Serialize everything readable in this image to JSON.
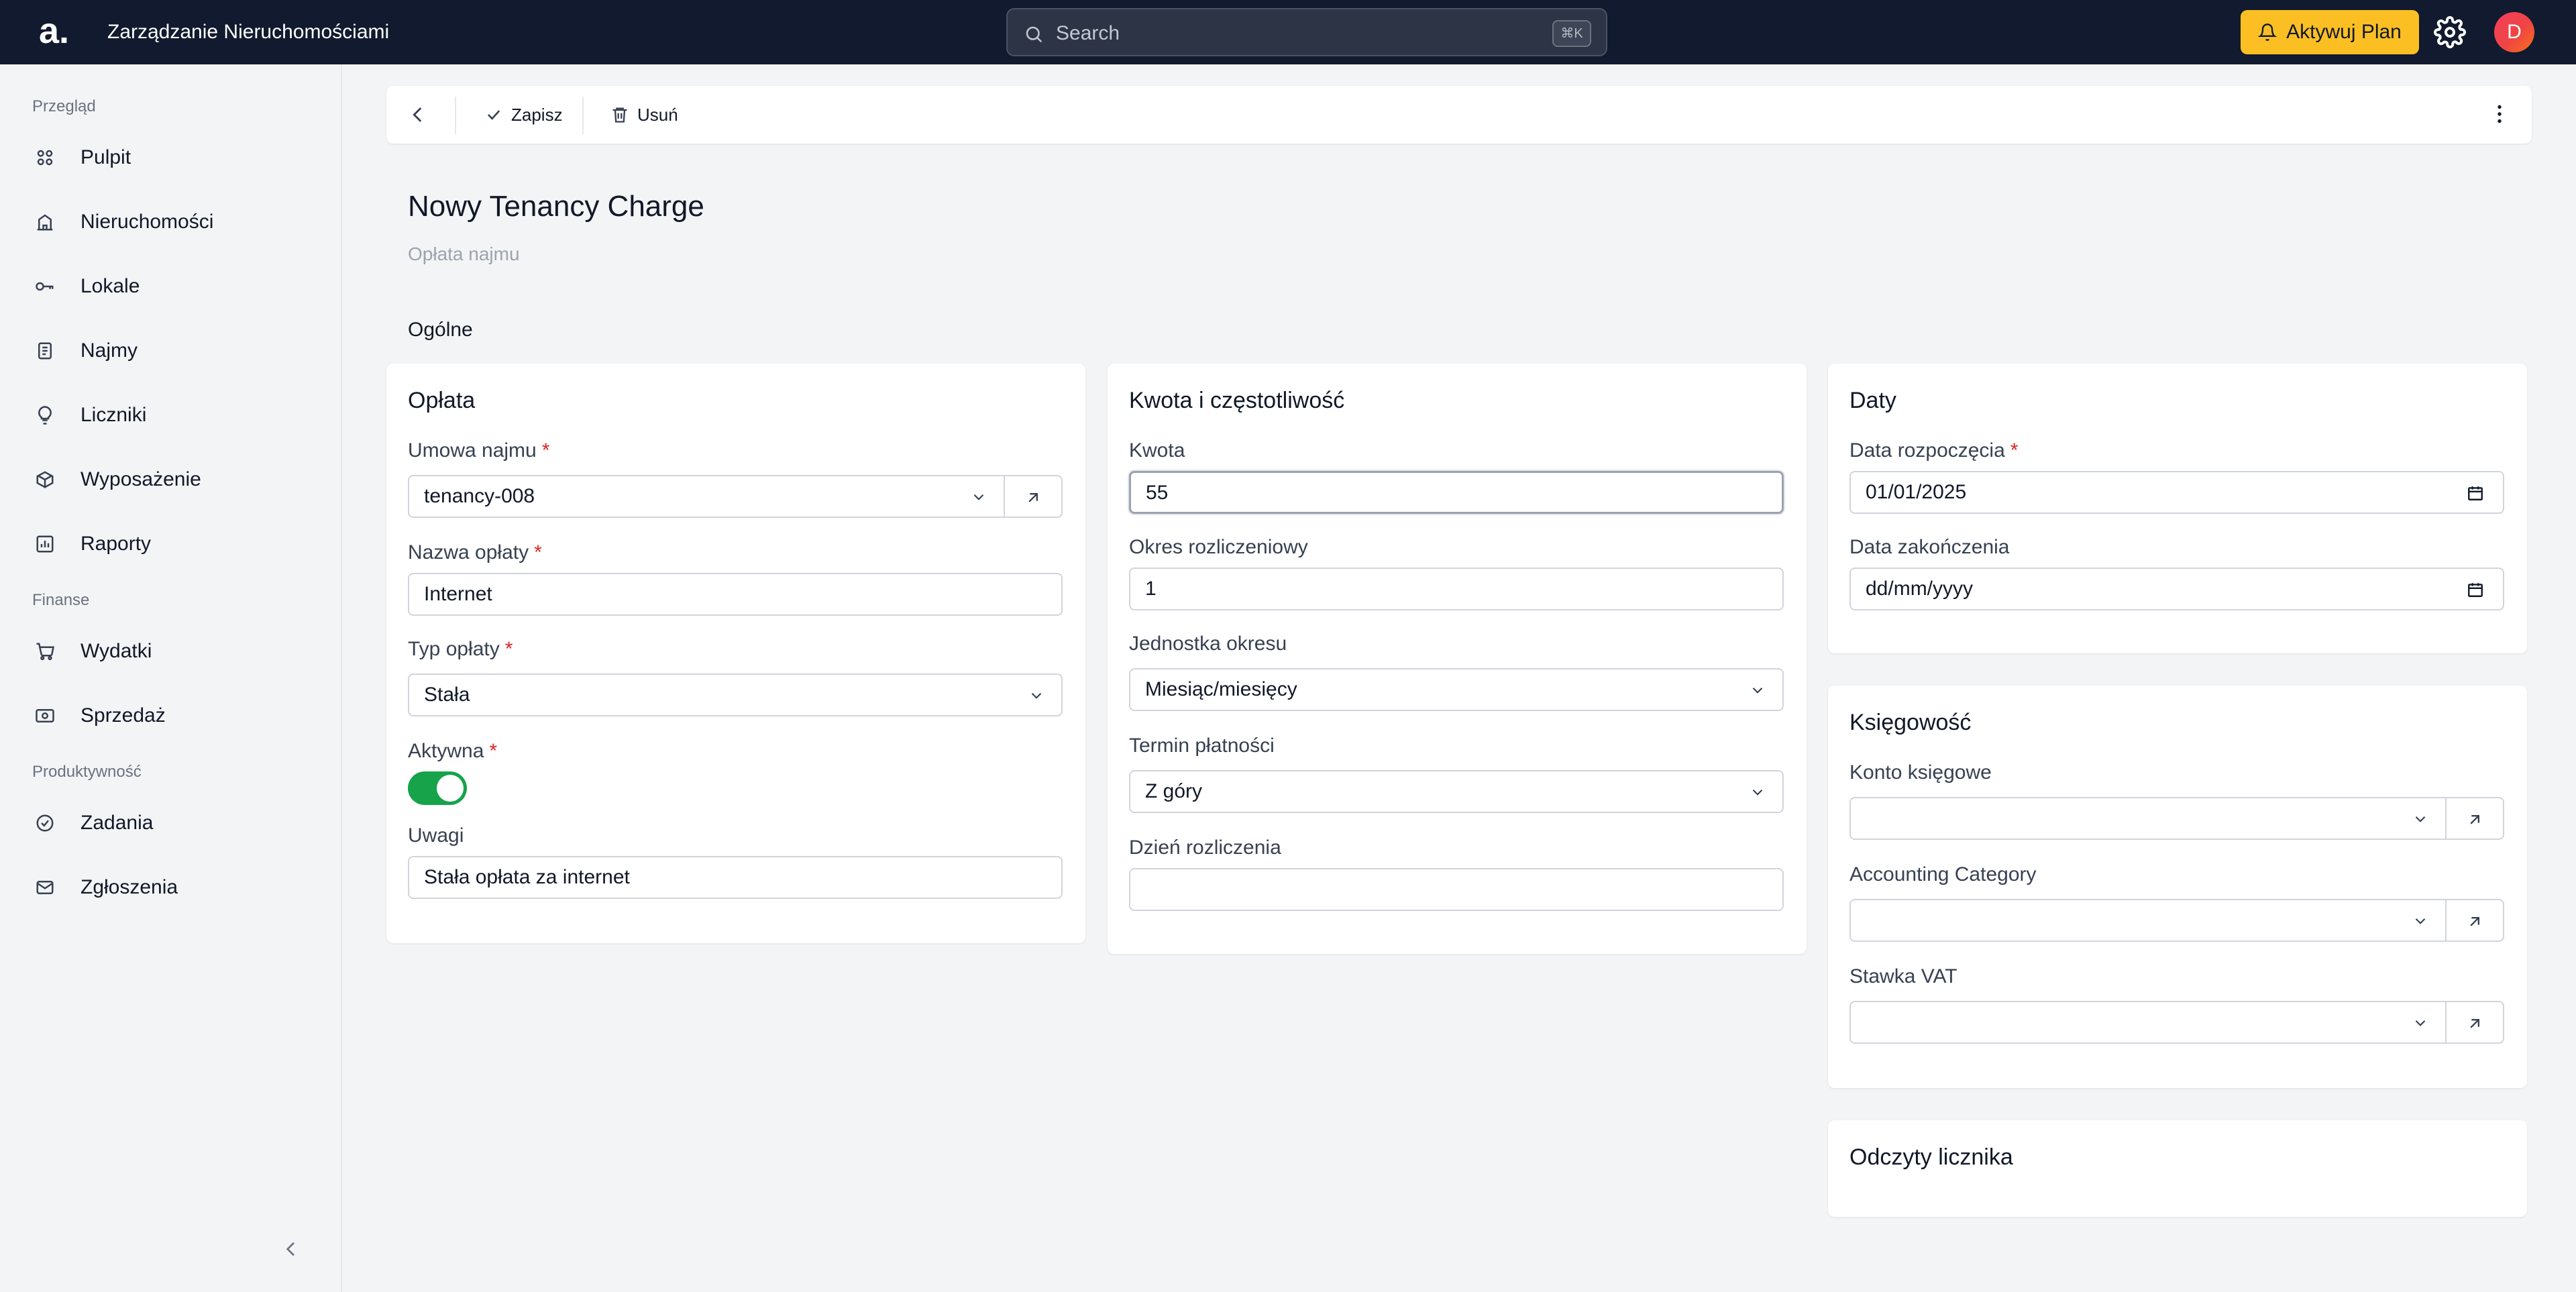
{
  "header": {
    "logo": "a.",
    "app_title": "Zarządzanie Nieruchomościami",
    "search_placeholder": "Search",
    "search_shortcut": "⌘K",
    "plan_button": "Aktywuj Plan",
    "avatar_initial": "D"
  },
  "sidebar": {
    "sections": [
      "Przegląd",
      "Finanse",
      "Produktywność"
    ],
    "items": [
      {
        "label": "Pulpit",
        "icon": "grid-icon"
      },
      {
        "label": "Nieruchomości",
        "icon": "building-icon"
      },
      {
        "label": "Lokale",
        "icon": "key-icon"
      },
      {
        "label": "Najmy",
        "icon": "document-icon"
      },
      {
        "label": "Liczniki",
        "icon": "lightbulb-icon"
      },
      {
        "label": "Wyposażenie",
        "icon": "box-icon"
      },
      {
        "label": "Raporty",
        "icon": "chart-icon"
      },
      {
        "label": "Wydatki",
        "icon": "cart-icon"
      },
      {
        "label": "Sprzedaż",
        "icon": "cash-icon"
      },
      {
        "label": "Zadania",
        "icon": "check-circle-icon"
      },
      {
        "label": "Zgłoszenia",
        "icon": "mail-icon"
      }
    ]
  },
  "toolbar": {
    "save_label": "Zapisz",
    "delete_label": "Usuń"
  },
  "page": {
    "title": "Nowy Tenancy Charge",
    "subtitle": "Opłata najmu",
    "section": "Ogólne"
  },
  "cards": {
    "charge": {
      "title": "Opłata",
      "lease_label": "Umowa najmu",
      "lease_value": "tenancy-008",
      "name_label": "Nazwa opłaty",
      "name_value": "Internet",
      "type_label": "Typ opłaty",
      "type_value": "Stała",
      "active_label": "Aktywna",
      "active_value": true,
      "notes_label": "Uwagi",
      "notes_value": "Stała opłata za internet"
    },
    "amount": {
      "title": "Kwota i częstotliwość",
      "amount_label": "Kwota",
      "amount_value": "55",
      "period_label": "Okres rozliczeniowy",
      "period_value": "1",
      "unit_label": "Jednostka okresu",
      "unit_value": "Miesiąc/miesięcy",
      "due_label": "Termin płatności",
      "due_value": "Z góry",
      "billing_day_label": "Dzień rozliczenia",
      "billing_day_value": ""
    },
    "dates": {
      "title": "Daty",
      "start_label": "Data rozpoczęcia",
      "start_value": "01/01/2025",
      "end_label": "Data zakończenia",
      "end_value": "dd/mm/yyyy"
    },
    "accounting": {
      "title": "Księgowość",
      "account_label": "Konto księgowe",
      "account_value": "",
      "category_label": "Accounting Category",
      "category_value": "",
      "vat_label": "Stawka VAT",
      "vat_value": ""
    },
    "readings": {
      "title": "Odczyty licznika"
    }
  },
  "colors": {
    "topbar": "#111a2e",
    "accent": "#fbbf24",
    "toggle_on": "#16a34a",
    "required": "#dc2626"
  }
}
